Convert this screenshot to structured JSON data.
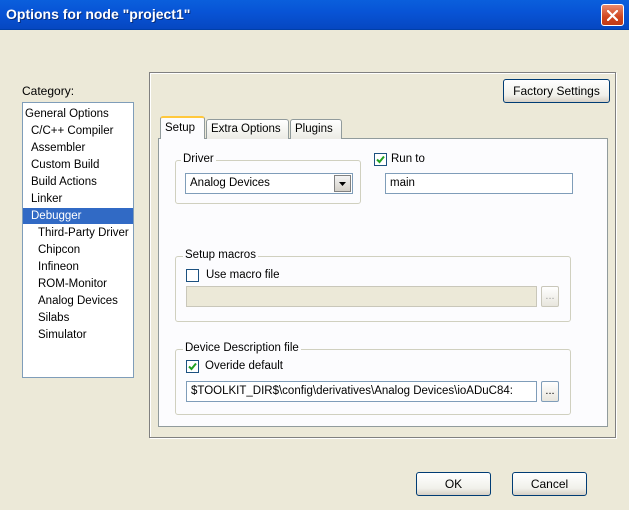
{
  "window": {
    "title": "Options for node \"project1\""
  },
  "category": {
    "label": "Category:",
    "items": [
      {
        "label": "General Options"
      },
      {
        "label": "C/C++ Compiler"
      },
      {
        "label": "Assembler"
      },
      {
        "label": "Custom Build"
      },
      {
        "label": "Build Actions"
      },
      {
        "label": "Linker"
      },
      {
        "label": "Debugger"
      },
      {
        "label": "Third-Party Driver"
      },
      {
        "label": "Chipcon"
      },
      {
        "label": "Infineon"
      },
      {
        "label": "ROM-Monitor"
      },
      {
        "label": "Analog Devices"
      },
      {
        "label": "Silabs"
      },
      {
        "label": "Simulator"
      }
    ],
    "selected": "Debugger"
  },
  "buttons": {
    "factory": "Factory Settings",
    "ok": "OK",
    "cancel": "Cancel"
  },
  "tabs": [
    {
      "label": "Setup"
    },
    {
      "label": "Extra Options"
    },
    {
      "label": "Plugins"
    }
  ],
  "setup": {
    "driver": {
      "group_label": "Driver",
      "selected": "Analog Devices"
    },
    "run_to": {
      "label": "Run to",
      "checked": true,
      "value": "main"
    },
    "macros": {
      "group_label": "Setup macros",
      "use_label": "Use macro file",
      "checked": false,
      "value": ""
    },
    "device": {
      "group_label": "Device Description file",
      "override_label": "Overide default",
      "checked": true,
      "value": "$TOOLKIT_DIR$\\config\\derivatives\\Analog Devices\\ioADuC84:"
    },
    "browse_label": "..."
  },
  "colors": {
    "selection": "#316AC5",
    "titlebar": "#0A5FDC",
    "tab_highlight": "#FFC83C"
  }
}
